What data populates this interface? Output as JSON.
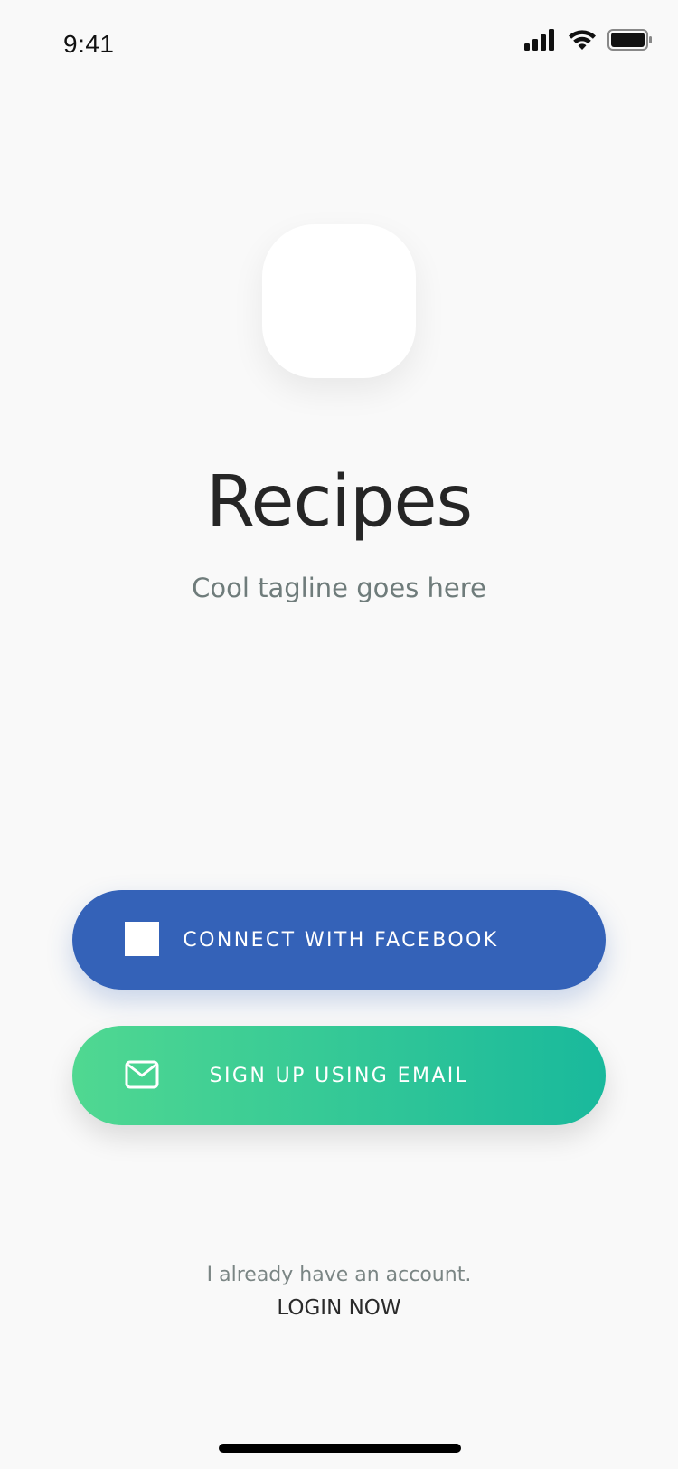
{
  "status_bar": {
    "time": "9:41",
    "icons": [
      "signal-icon",
      "wifi-icon",
      "battery-icon"
    ]
  },
  "app": {
    "title": "Recipes",
    "tagline": "Cool tagline goes here"
  },
  "buttons": {
    "facebook": {
      "label": "CONNECT WITH FACEBOOK",
      "icon": "facebook-icon",
      "color": "#3462b8"
    },
    "email": {
      "label": "SIGN UP USING EMAIL",
      "icon": "mail-icon",
      "gradient_start": "#50d891",
      "gradient_end": "#19b99c"
    }
  },
  "footer": {
    "account_text": "I already have an account.",
    "login_label": "LOGIN NOW"
  }
}
